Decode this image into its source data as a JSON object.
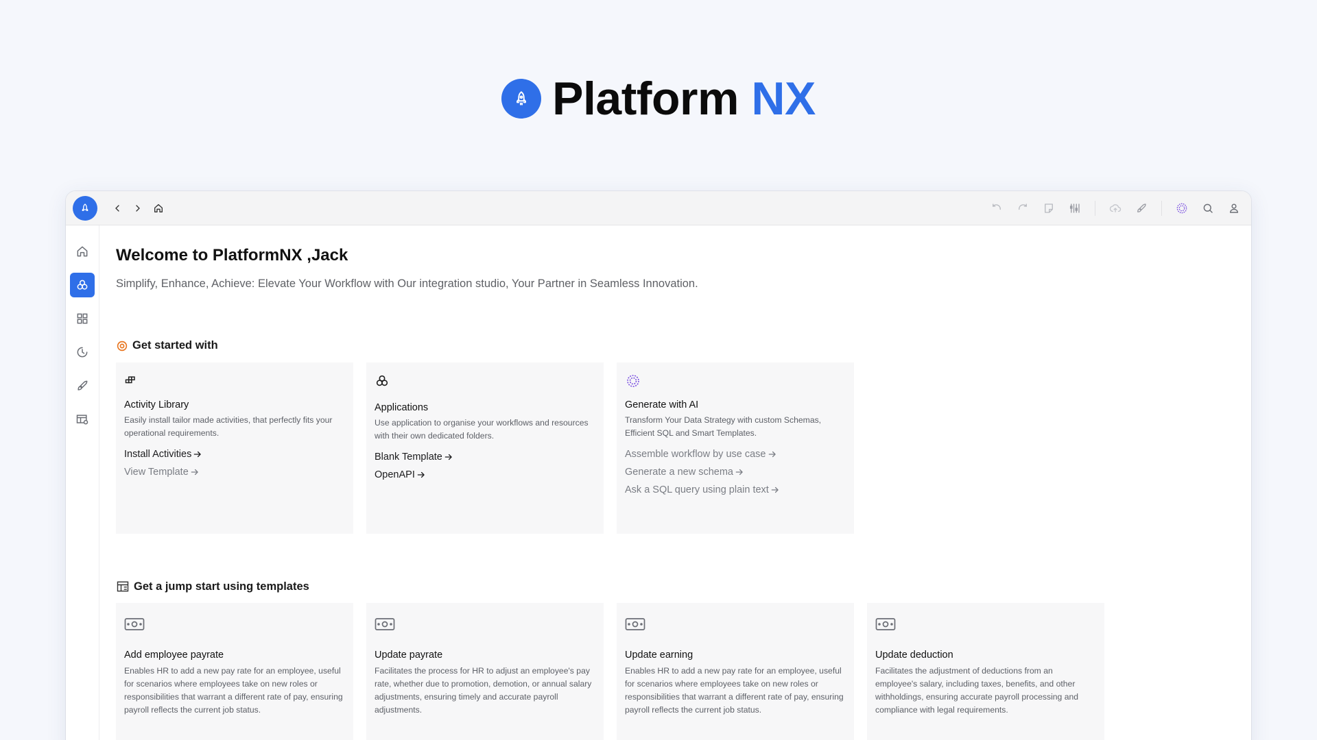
{
  "brand": {
    "name": "Platform",
    "accent": "NX",
    "accent_color": "#2f6fe8"
  },
  "topbar": {
    "icons": [
      "rocket-icon",
      "chevron-left-icon",
      "chevron-right-icon",
      "home-icon",
      "undo-icon",
      "redo-icon",
      "note-icon",
      "sliders-icon",
      "cloud-upload-icon",
      "deploy-rocket-icon",
      "ai-sparkle-icon",
      "search-icon",
      "user-icon"
    ]
  },
  "sidebar": {
    "items": [
      {
        "icon": "home-icon",
        "active": false
      },
      {
        "icon": "applications-icon",
        "active": true
      },
      {
        "icon": "grid-icon",
        "active": false
      },
      {
        "icon": "history-icon",
        "active": false
      },
      {
        "icon": "plug-icon",
        "active": false
      },
      {
        "icon": "table-settings-icon",
        "active": false
      }
    ]
  },
  "main": {
    "welcome": "Welcome to PlatformNX ,Jack",
    "subtitle": "Simplify, Enhance, Achieve: Elevate Your Workflow with Our integration studio, Your Partner in Seamless Innovation.",
    "get_started": {
      "title": "Get started with",
      "cards": [
        {
          "title": "Activity Library",
          "desc": "Easily install tailor made activities, that perfectly fits your operational requirements.",
          "links": [
            "Install Activities",
            "View Template"
          ]
        },
        {
          "title": "Applications",
          "desc": "Use application to organise your workflows and resources with their own dedicated folders.",
          "links": [
            "Blank Template",
            "OpenAPI"
          ]
        },
        {
          "title": "Generate with AI",
          "desc": "Transform Your Data Strategy with custom Schemas, Efficient SQL and Smart Templates.",
          "links": [
            "Assemble workflow by use case",
            "Generate a new schema",
            "Ask a SQL query using plain text"
          ]
        }
      ]
    },
    "templates": {
      "title": "Get a jump start using templates",
      "cards": [
        {
          "title": "Add employee payrate",
          "desc": "Enables HR to add a new pay rate for an employee, useful for scenarios where employees take on new roles or responsibilities that warrant a different rate of pay, ensuring payroll reflects the current job status."
        },
        {
          "title": "Update payrate",
          "desc": "Facilitates the process for HR to adjust an employee's pay rate, whether due to promotion, demotion, or annual salary adjustments, ensuring timely and accurate payroll adjustments."
        },
        {
          "title": "Update earning",
          "desc": "Enables HR to add a new pay rate for an employee, useful for scenarios where employees take on new roles or responsibilities that warrant a different rate of pay, ensuring payroll reflects the current job status."
        },
        {
          "title": "Update deduction",
          "desc": "Facilitates the adjustment of deductions from an employee's salary, including taxes, benefits, and other withholdings, ensuring accurate payroll processing and compliance with legal requirements."
        }
      ]
    }
  }
}
